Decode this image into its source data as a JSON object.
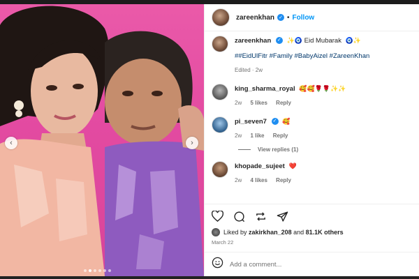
{
  "author": {
    "username": "zareenkhan",
    "follow_label": "Follow",
    "dot": "•"
  },
  "caption": {
    "username": "zareenkhan",
    "text": "Eid Mubarak",
    "emoji_pre": "✨🧿",
    "emoji_post": "🧿✨",
    "hashtags": "##EidUlFitr #Family #BabyAizel #ZareenKhan",
    "edited": "Edited · 2w"
  },
  "comments": [
    {
      "username": "king_sharma_royal",
      "text": "🥰🥰🌹🌹✨✨",
      "time": "2w",
      "likes": "5 likes",
      "reply": "Reply"
    },
    {
      "username": "pi_seven7",
      "text": "🥰",
      "time": "2w",
      "likes": "1 like",
      "reply": "Reply",
      "view_replies": "View replies (1)"
    },
    {
      "username": "khopade_sujeet",
      "text": "❤️",
      "time": "2w",
      "likes": "4 likes",
      "reply": "Reply"
    }
  ],
  "likes": {
    "prefix": "Liked by",
    "user": "zakirkhan_208",
    "joiner": "and",
    "others": "81.1K others"
  },
  "post_date": "March 22",
  "add_comment": {
    "placeholder": "Add a comment..."
  },
  "media": {
    "prev_icon": "‹",
    "next_icon": "›"
  },
  "colors": {
    "accent": "#0095f6",
    "verified": "#1f8ef1",
    "hashtag": "#00376b",
    "photo_bg": "#e84fa3"
  }
}
